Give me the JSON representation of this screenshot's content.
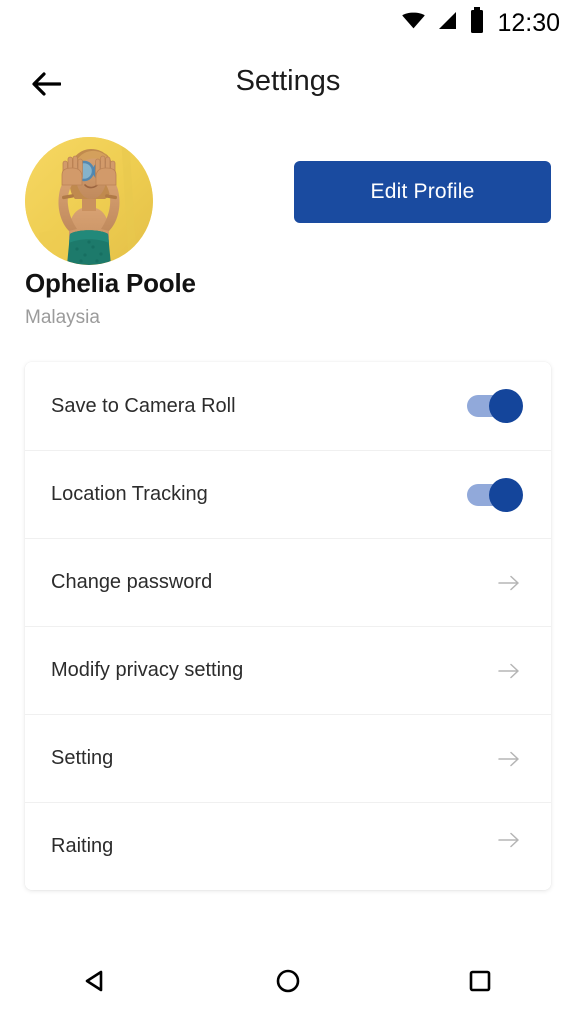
{
  "status_bar": {
    "time": "12:30",
    "icons": [
      "wifi-icon",
      "cellular-signal-icon",
      "battery-icon"
    ]
  },
  "header": {
    "title": "Settings",
    "back_icon": "back-arrow-icon"
  },
  "profile": {
    "name": "Ophelia Poole",
    "location": "Malaysia",
    "avatar_alt": "user-avatar",
    "edit_button_label": "Edit Profile"
  },
  "settings": {
    "rows": [
      {
        "label": "Save to Camera Roll",
        "control": "toggle",
        "value": "on"
      },
      {
        "label": "Location Tracking",
        "control": "toggle",
        "value": "on"
      },
      {
        "label": "Change password",
        "control": "chevron"
      },
      {
        "label": "Modify privacy setting",
        "control": "chevron"
      },
      {
        "label": "Setting",
        "control": "chevron"
      },
      {
        "label": "Raiting",
        "control": "chevron"
      }
    ]
  },
  "nav_bar": {
    "back": "nav-back-triangle-icon",
    "home": "nav-home-circle-icon",
    "recents": "nav-recents-square-icon"
  },
  "colors": {
    "accent_blue": "#1a4ba0",
    "toggle_track": "#91a9da",
    "toggle_knob": "#14459b",
    "text_primary": "#1b1b1b",
    "text_secondary": "#9b9b9b",
    "chevron": "#b5b5b5",
    "divider": "#f0f0f0",
    "background": "#ffffff",
    "avatar_background": "#f2cf52"
  }
}
